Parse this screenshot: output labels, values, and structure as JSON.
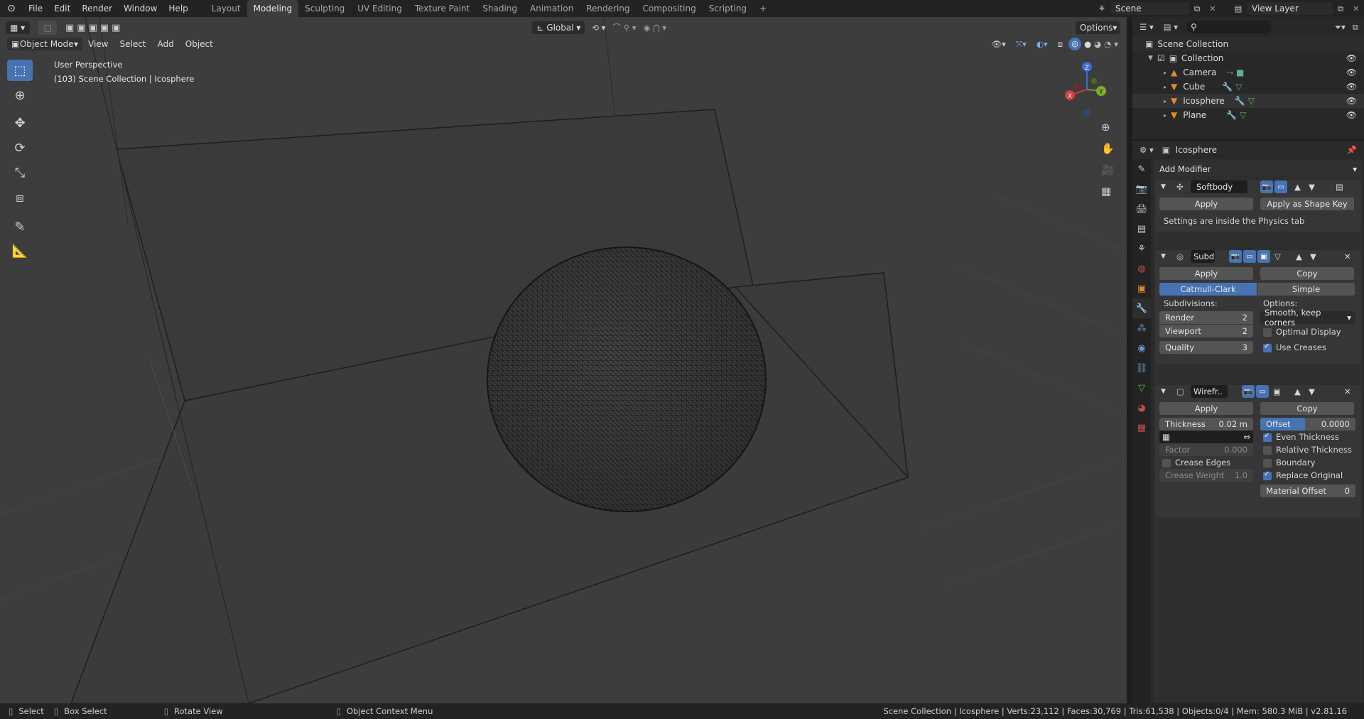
{
  "topbar": {
    "menus": [
      "File",
      "Edit",
      "Render",
      "Window",
      "Help"
    ],
    "workspaces": [
      "Layout",
      "Modeling",
      "Sculpting",
      "UV Editing",
      "Texture Paint",
      "Shading",
      "Animation",
      "Rendering",
      "Compositing",
      "Scripting"
    ],
    "active_workspace": "Modeling",
    "add_tab": "+",
    "scene": "Scene",
    "view_layer": "View Layer"
  },
  "viewport": {
    "mode": "Object Mode",
    "menus": [
      "View",
      "Select",
      "Add",
      "Object"
    ],
    "orientation": "Global",
    "options": "Options",
    "overlay_title": "User Perspective",
    "overlay_sub": "(103) Scene Collection | Icosphere",
    "gizmo": {
      "x": "X",
      "y": "Y",
      "z": "Z"
    }
  },
  "outliner": {
    "root": "Scene Collection",
    "collection": "Collection",
    "items": [
      "Camera",
      "Cube",
      "Icosphere",
      "Plane"
    ]
  },
  "properties": {
    "object_name": "Icosphere",
    "add_modifier": "Add Modifier",
    "softbody": {
      "name": "Softbody",
      "apply": "Apply",
      "apply_shape": "Apply as Shape Key",
      "note": "Settings are inside the Physics tab"
    },
    "subd": {
      "name": "Subd",
      "apply": "Apply",
      "copy": "Copy",
      "catmull": "Catmull-Clark",
      "simple": "Simple",
      "subdivisions": "Subdivisions:",
      "options": "Options:",
      "render_label": "Render",
      "render_val": "2",
      "viewport_label": "Viewport",
      "viewport_val": "2",
      "quality_label": "Quality",
      "quality_val": "3",
      "uv_option": "Smooth, keep corners",
      "optimal": "Optimal Display",
      "creases": "Use Creases"
    },
    "wire": {
      "name": "Wirefr..",
      "apply": "Apply",
      "copy": "Copy",
      "thickness_label": "Thickness",
      "thickness_val": "0.02 m",
      "offset_label": "Offset",
      "offset_val": "0.0000",
      "even": "Even Thickness",
      "relative": "Relative Thickness",
      "factor_label": "Factor",
      "factor_val": "0.000",
      "boundary": "Boundary",
      "crease_edges": "Crease Edges",
      "replace": "Replace Original",
      "crease_weight_label": "Crease Weight",
      "crease_weight_val": "1.0",
      "material_offset_label": "Material Offset",
      "material_offset_val": "0"
    }
  },
  "statusbar": {
    "select": "Select",
    "box_select": "Box Select",
    "rotate": "Rotate View",
    "context": "Object Context Menu",
    "stats": "Scene Collection | Icosphere | Verts:23,112 | Faces:30,769 | Tris:61,538 | Objects:0/4 | Mem: 580.3 MiB | v2.81.16"
  }
}
